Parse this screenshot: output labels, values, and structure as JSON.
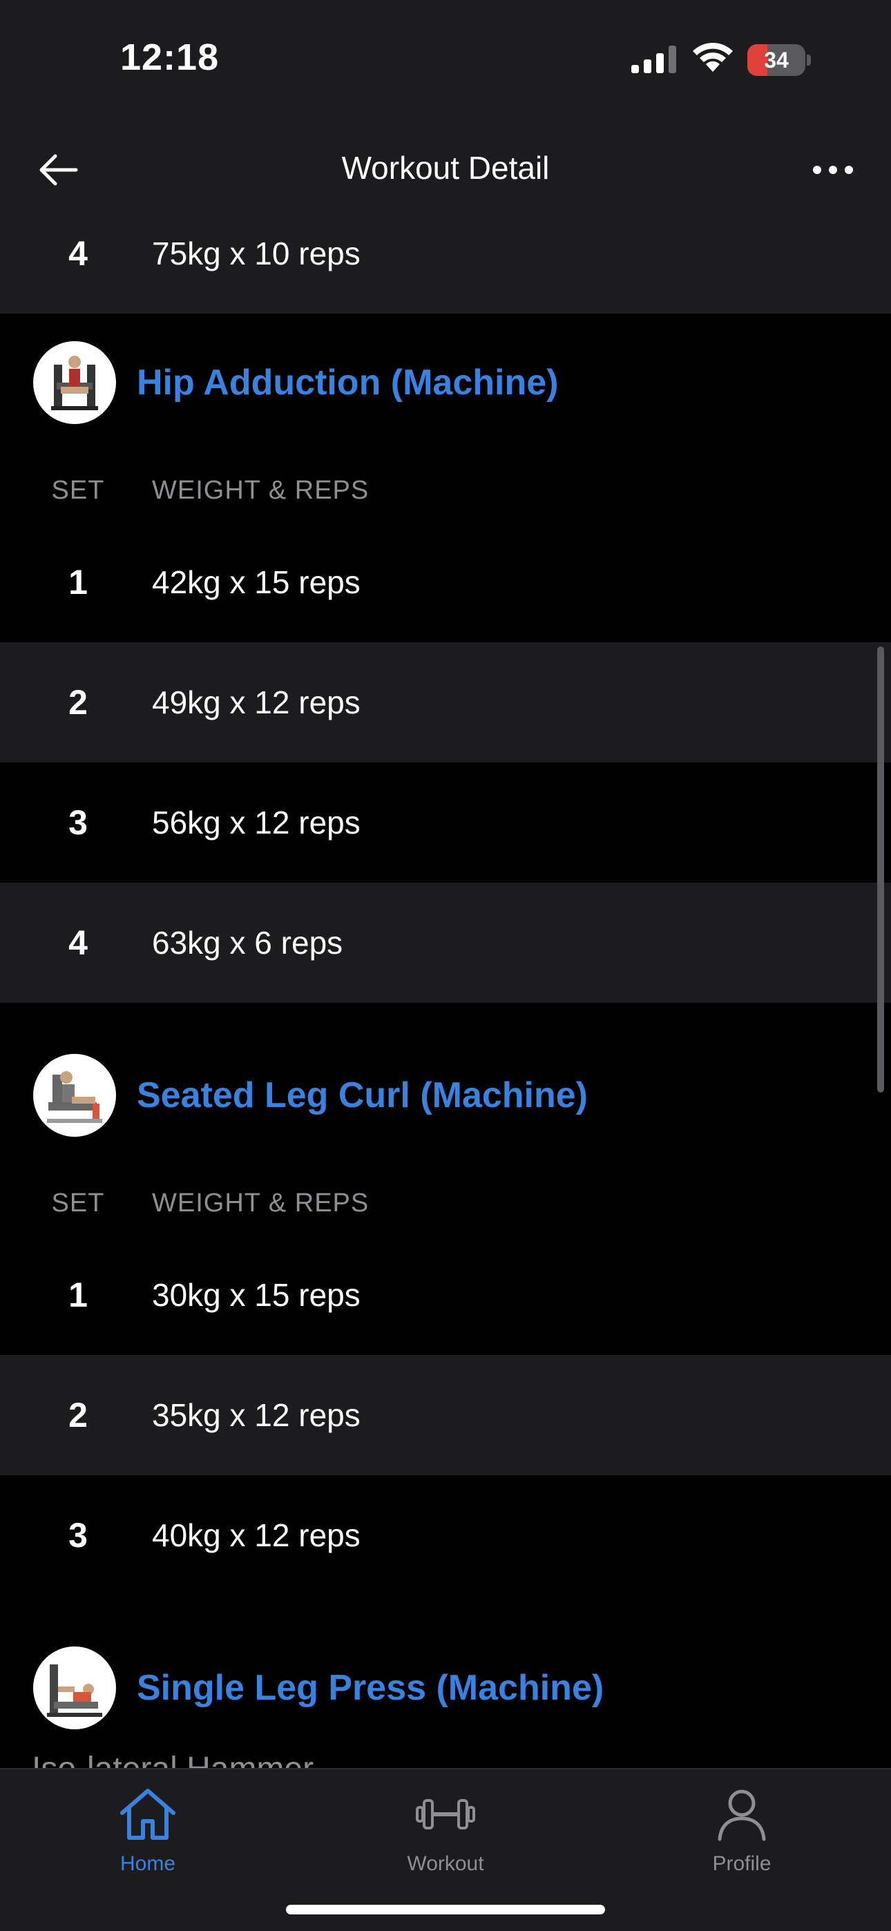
{
  "status_bar": {
    "time": "12:18",
    "battery": "34",
    "battery_level": 0.34
  },
  "nav": {
    "title": "Workout Detail"
  },
  "previous_exercise": {
    "last_set": {
      "set": "4",
      "value": "75kg x 10 reps"
    }
  },
  "exercises": [
    {
      "name": "Hip Adduction (Machine)",
      "col_set": "SET",
      "col_weight_reps": "WEIGHT & REPS",
      "sets": [
        {
          "set": "1",
          "value": "42kg x 15 reps"
        },
        {
          "set": "2",
          "value": "49kg x 12 reps"
        },
        {
          "set": "3",
          "value": "56kg x 12 reps"
        },
        {
          "set": "4",
          "value": "63kg x 6 reps"
        }
      ]
    },
    {
      "name": "Seated Leg Curl (Machine)",
      "col_set": "SET",
      "col_weight_reps": "WEIGHT & REPS",
      "sets": [
        {
          "set": "1",
          "value": "30kg x 15 reps"
        },
        {
          "set": "2",
          "value": "35kg x 12 reps"
        },
        {
          "set": "3",
          "value": "40kg x 12 reps"
        }
      ]
    },
    {
      "name": "Single Leg Press (Machine)",
      "partial_text": "Iso-lateral Hammer"
    }
  ],
  "tabs": [
    {
      "label": "Home",
      "icon": "home-icon",
      "active": true
    },
    {
      "label": "Workout",
      "icon": "dumbbell-icon",
      "active": false
    },
    {
      "label": "Profile",
      "icon": "profile-icon",
      "active": false
    }
  ],
  "colors": {
    "accent": "#3a82e0",
    "background": "#000000",
    "surface": "#1c1c1e",
    "muted": "#8e8e93"
  }
}
